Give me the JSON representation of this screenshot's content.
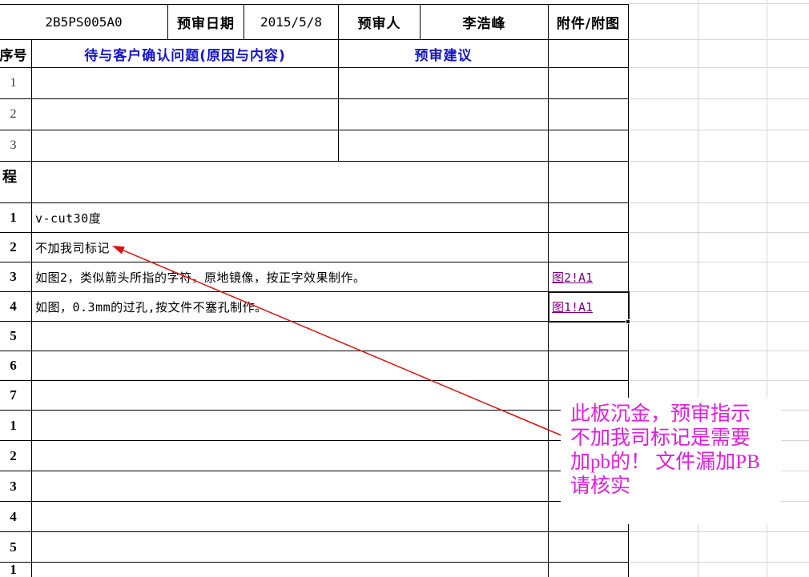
{
  "sheet": {
    "header_row": {
      "doc_id": "2B5PS005A0",
      "date_label": "预审日期",
      "date_value": "2015/5/8",
      "reviewer_label": "预审人",
      "reviewer_value": "李浩峰",
      "attachment_label": "附件/附图"
    },
    "column_headers": {
      "seq": "序号",
      "issues": "待与客户确认问题(原因与内容)",
      "suggestions": "预审建议"
    },
    "confirm_rows": [
      {
        "no": "1"
      },
      {
        "no": "2"
      },
      {
        "no": "3"
      }
    ],
    "section_label": "程",
    "process_rows": [
      {
        "no": "1",
        "text": "v-cut30度"
      },
      {
        "no": "2",
        "text": "不加我司标记"
      },
      {
        "no": "3",
        "text": "如图2，类似箭头所指的字符，原地镜像，按正字效果制作。",
        "link": "图2!A1"
      },
      {
        "no": "4",
        "text": "如图，0.3mm的过孔,按文件不塞孔制作。",
        "link": "图1!A1"
      },
      {
        "no": "5"
      },
      {
        "no": "6"
      },
      {
        "no": "7"
      },
      {
        "no": "1"
      },
      {
        "no": "2"
      },
      {
        "no": "3"
      },
      {
        "no": "4"
      },
      {
        "no": "5"
      },
      {
        "no": "1"
      }
    ]
  },
  "annotation": {
    "lines": [
      "此板沉金，预审指示",
      "不加我司标记是需要",
      "加pb的！ 文件漏加PB",
      "请核实"
    ]
  },
  "colors": {
    "border": "#000000",
    "grid": "#d6d6d6",
    "header_blue": "#1414c8",
    "link_purple": "#800080",
    "annotation_magenta": "#e01ee0",
    "arrow_red": "#dd1111"
  }
}
